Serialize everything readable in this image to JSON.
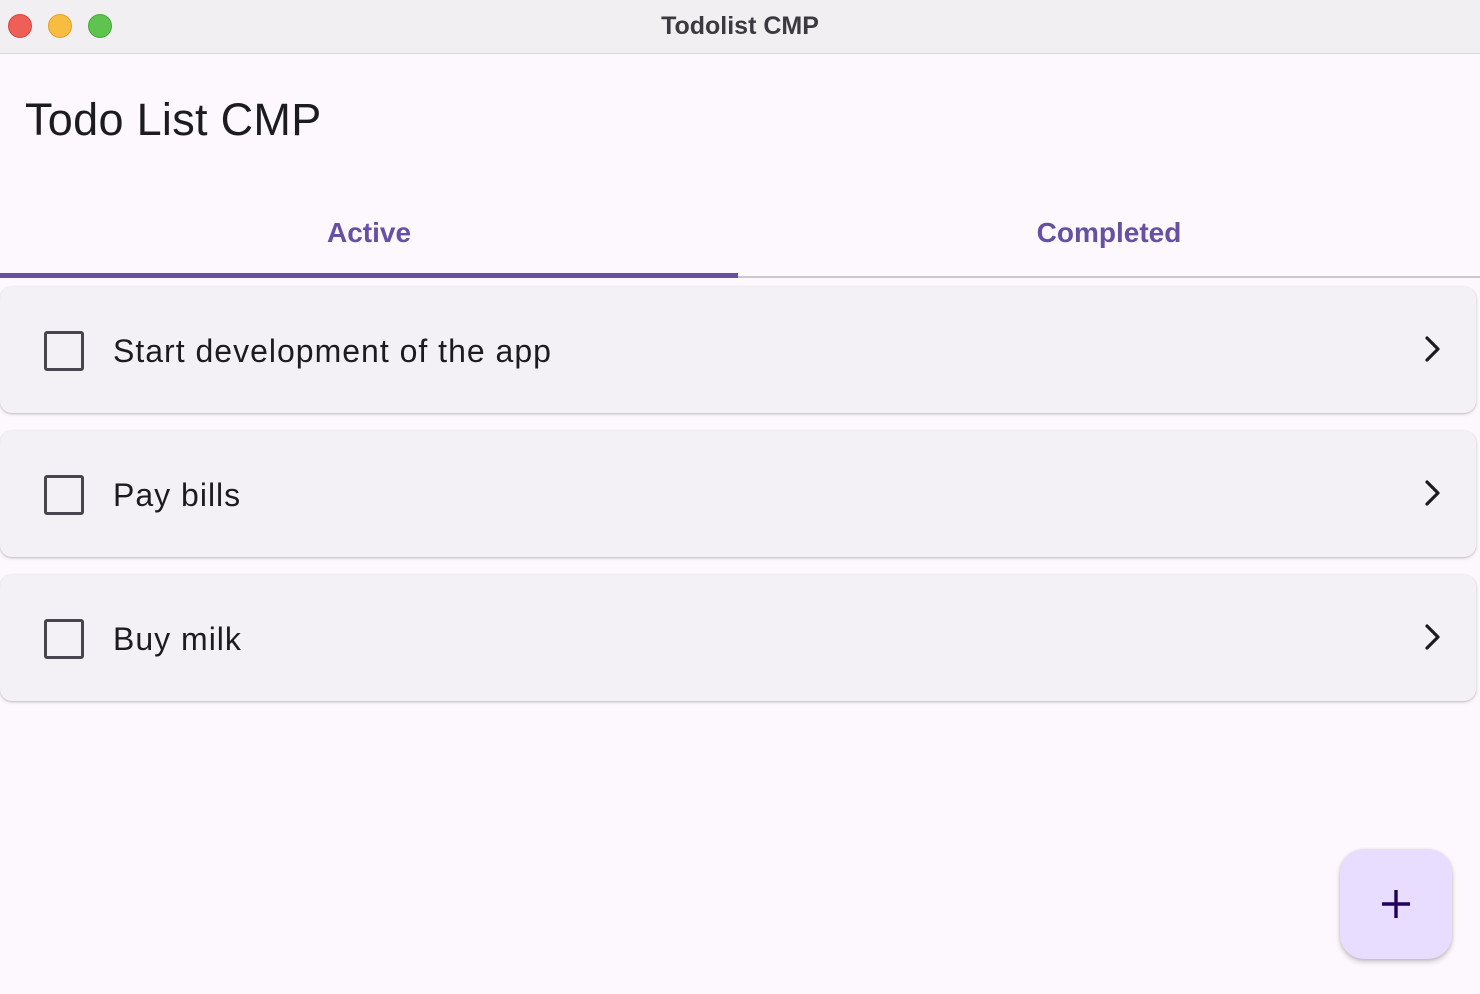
{
  "window": {
    "title": "Todolist CMP"
  },
  "app": {
    "title": "Todo List CMP"
  },
  "tabs": [
    {
      "label": "Active",
      "selected": true
    },
    {
      "label": "Completed",
      "selected": false
    }
  ],
  "todos": [
    {
      "text": "Start development of the app",
      "checked": false,
      "icon": "chevron-right-icon"
    },
    {
      "text": "Pay bills",
      "checked": false,
      "icon": "chevron-right-icon"
    },
    {
      "text": "Buy milk",
      "checked": false,
      "icon": "chevron-right-icon"
    }
  ],
  "fab": {
    "icon": "plus-icon"
  },
  "colors": {
    "primary": "#6550a4",
    "background": "#fdf8fd",
    "card": "#f3f1f6",
    "fab": "#e9ddff",
    "text": "#1c1b1f"
  }
}
